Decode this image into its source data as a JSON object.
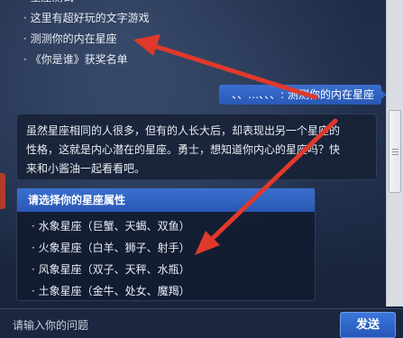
{
  "menu": {
    "items": [
      {
        "label": "· 星座测试"
      },
      {
        "label": "· 这里有超好玩的文字游戏"
      },
      {
        "label": "· 测测你的内在星座"
      },
      {
        "label": "· 《你是谁》获奖名单"
      }
    ]
  },
  "chat": {
    "user_message": "、、…、、、: 测测你的内在星座",
    "bot_message_line1": "虽然星座相同的人很多，但有的人长大后，却表现出另一个星座的",
    "bot_message_line2": "性格，这就是内心潜在的星座。勇士，想知道你内心的星座吗？快",
    "bot_message_line3": "来和小酱油一起看看吧。"
  },
  "options_card": {
    "title": "请选择你的星座属性",
    "options": [
      {
        "label": "· 水象星座（巨蟹、天蝎、双鱼）"
      },
      {
        "label": "· 火象星座（白羊、狮子、射手）"
      },
      {
        "label": "· 风象星座（双子、天秤、水瓶）"
      },
      {
        "label": "· 土象星座（金牛、处女、魔羯）"
      }
    ]
  },
  "input": {
    "placeholder": "请输入你的问题",
    "send_label": "发送"
  },
  "colors": {
    "background": "#1a2640",
    "accent_blue": "#2f62c2",
    "arrow_red": "#e0392b"
  }
}
